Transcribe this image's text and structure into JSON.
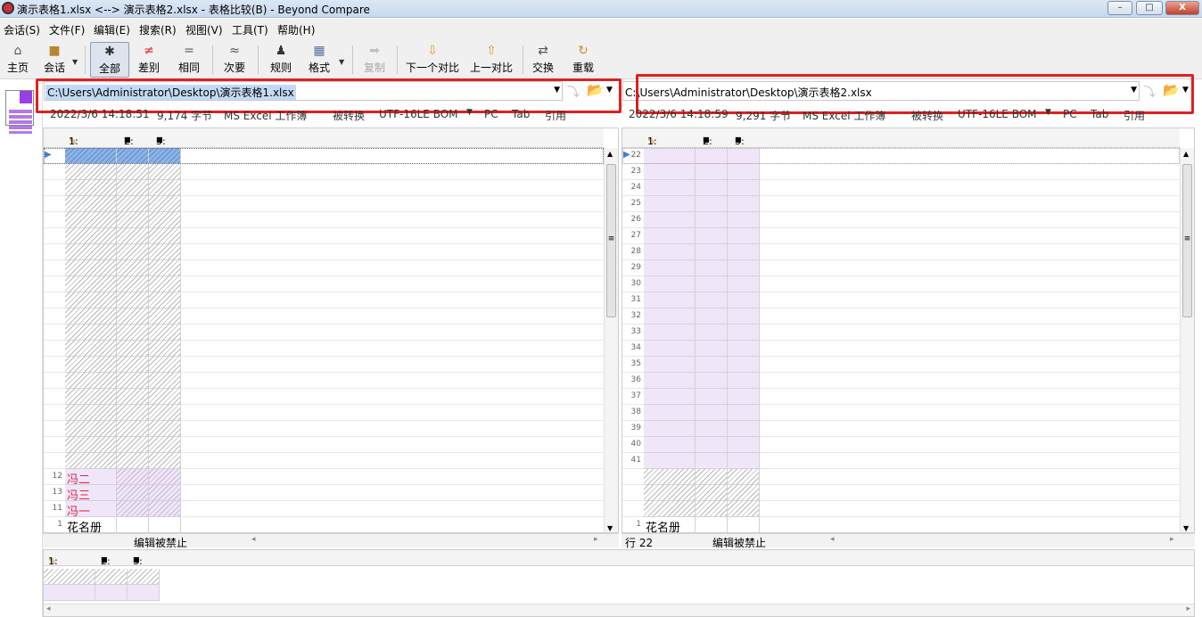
{
  "window": {
    "title": "演示表格1.xlsx <--> 演示表格2.xlsx - 表格比较(B) - Beyond Compare",
    "min_label": "–",
    "max_label": "□",
    "close_label": "X"
  },
  "menu": [
    "会话(S)",
    "文件(F)",
    "编辑(E)",
    "搜索(R)",
    "视图(V)",
    "工具(T)",
    "帮助(H)"
  ],
  "toolbar": {
    "home": "主页",
    "session": "会话",
    "all": "全部",
    "diffs": "差别",
    "same": "相同",
    "minor": "次要",
    "rules": "规则",
    "format": "格式",
    "copy": "复制",
    "next_diff": "下一个对比",
    "prev_diff": "上一对比",
    "swap": "交换",
    "reload": "重载"
  },
  "left": {
    "path": "C:\\Users\\Administrator\\Desktop\\演示表格1.xlsx",
    "info": [
      "2022/3/6 14:18:51",
      "9,174 字节",
      "MS Excel 工作簿",
      "被转换",
      "UTF-16LE BOM",
      "PC",
      "Tab",
      "引用"
    ],
    "cols": [
      "1:",
      "2:",
      "3:"
    ],
    "rows": [
      {
        "num": "12",
        "text": "冯二",
        "red": true
      },
      {
        "num": "13",
        "text": "冯三",
        "red": true
      },
      {
        "num": "11",
        "text": "冯一",
        "red": true
      },
      {
        "num": "1",
        "text": "花名册",
        "red": false
      }
    ],
    "status": "编辑被禁止"
  },
  "right": {
    "path": "C:\\Users\\Administrator\\Desktop\\演示表格2.xlsx",
    "info": [
      "2022/3/6 14:18:59",
      "9,291 字节",
      "MS Excel 工作簿",
      "被转换",
      "UTF-16LE BOM",
      "PC",
      "Tab",
      "引用"
    ],
    "cols": [
      "1:",
      "2:",
      "3:"
    ],
    "row_numbers": [
      "22",
      "23",
      "24",
      "25",
      "26",
      "27",
      "28",
      "29",
      "30",
      "31",
      "32",
      "33",
      "34",
      "35",
      "36",
      "37",
      "38",
      "39",
      "40",
      "41"
    ],
    "last_row": {
      "num": "1",
      "text": "花名册"
    },
    "status_row": "行 22",
    "status": "编辑被禁止"
  },
  "bottom": {
    "cols": [
      "1:",
      "2:",
      "3:"
    ]
  }
}
